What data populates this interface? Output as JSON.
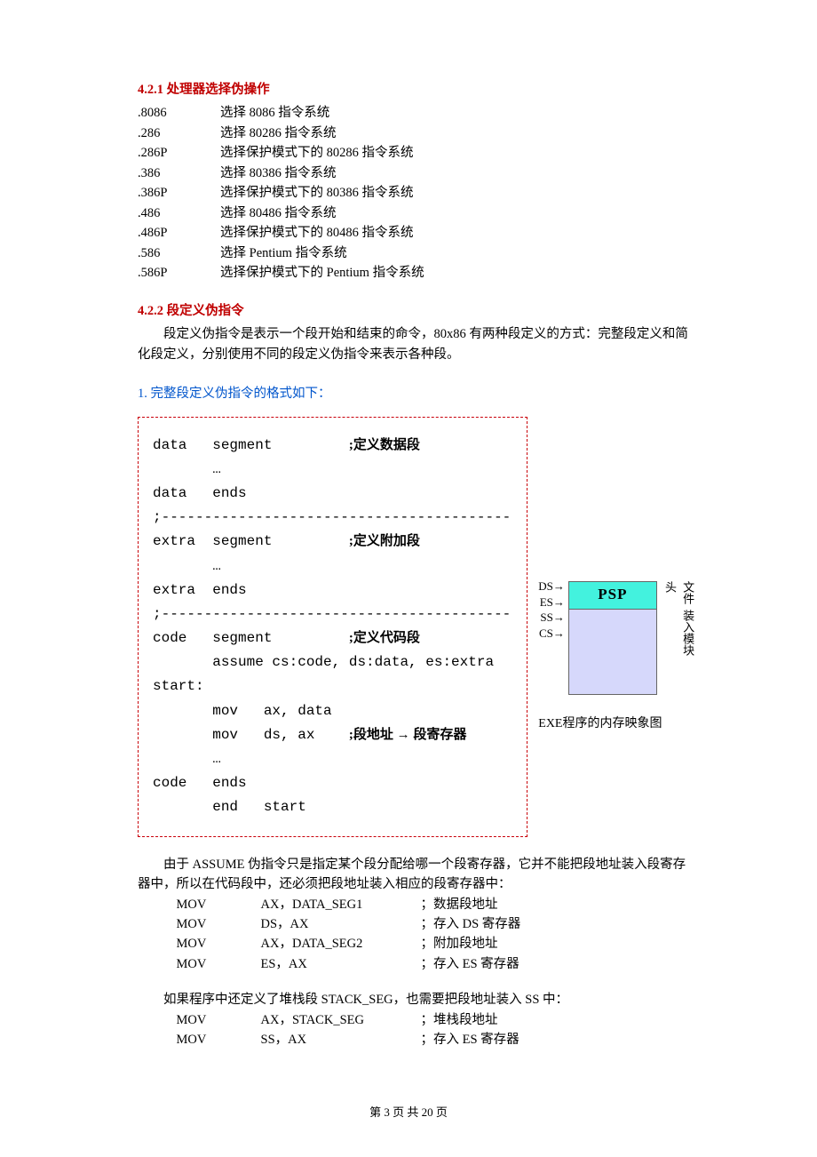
{
  "section421": {
    "title": "4.2.1  处理器选择伪操作",
    "rows": [
      {
        "d": ".8086",
        "t": "选择 8086 指令系统"
      },
      {
        "d": ".286",
        "t": "选择 80286 指令系统"
      },
      {
        "d": ".286P",
        "t": "选择保护模式下的 80286 指令系统"
      },
      {
        "d": ".386",
        "t": "选择 80386 指令系统"
      },
      {
        "d": ".386P",
        "t": "选择保护模式下的 80386 指令系统"
      },
      {
        "d": ".486",
        "t": "选择 80486 指令系统"
      },
      {
        "d": ".486P",
        "t": "选择保护模式下的 80486 指令系统"
      },
      {
        "d": ".586",
        "t": "选择 Pentium 指令系统"
      },
      {
        "d": ".586P",
        "t": "选择保护模式下的 Pentium 指令系统"
      }
    ]
  },
  "section422": {
    "title": "4.2.2  段定义伪指令",
    "intro": "段定义伪指令是表示一个段开始和结束的命令，80x86 有两种段定义的方式：完整段定义和简化段定义，分别使用不同的段定义伪指令来表示各种段。",
    "sub1": "1.  完整段定义伪指令的格式如下：",
    "code": "data   segment         ;定义数据段\n       …\ndata   ends\n;-----------------------------------------\nextra  segment         ;定义附加段\n       …\nextra  ends\n;-----------------------------------------\ncode   segment         ;定义代码段\n       assume cs:code, ds:data, es:extra\nstart:\n       mov   ax, data\n       mov   ds, ax    ;段地址 → 段寄存器\n       …\ncode   ends\n       end   start",
    "mem": {
      "ds": "DS→",
      "es": "ES→",
      "ss": "SS→",
      "cs": "CS→",
      "psp": "PSP",
      "r1": "文件头",
      "r2": "装入模块",
      "caption": "EXE程序的内存映象图"
    },
    "after": "由于 ASSUME 伪指令只是指定某个段分配给哪一个段寄存器，它并不能把段地址装入段寄存器中，所以在代码段中，还必须把段地址装入相应的段寄存器中：",
    "instr1": [
      {
        "a": "MOV",
        "b": "AX，DATA_SEG1",
        "c": "；数据段地址"
      },
      {
        "a": "MOV",
        "b": "DS，AX",
        "c": "；存入 DS 寄存器"
      },
      {
        "a": "MOV",
        "b": "AX，DATA_SEG2",
        "c": "；附加段地址"
      },
      {
        "a": "MOV",
        "b": "ES，AX",
        "c": "；存入 ES 寄存器"
      }
    ],
    "after2": "如果程序中还定义了堆栈段 STACK_SEG，也需要把段地址装入 SS 中：",
    "instr2": [
      {
        "a": "MOV",
        "b": "AX，STACK_SEG",
        "c": "；堆栈段地址"
      },
      {
        "a": "MOV",
        "b": "SS，AX",
        "c": "；存入 ES 寄存器"
      }
    ]
  },
  "pageNum": "第 3 页 共 20 页"
}
